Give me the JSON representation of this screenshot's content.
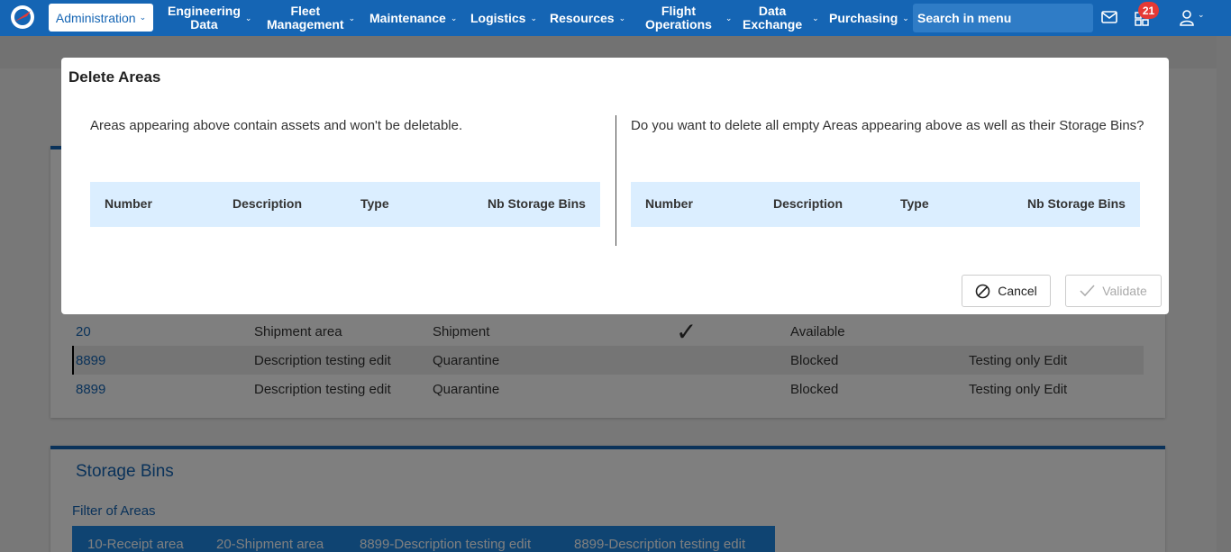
{
  "nav": {
    "admin": "Administration",
    "items": [
      {
        "l1": "Engineering",
        "l2": "Data"
      },
      {
        "l1": "Fleet",
        "l2": "Management"
      },
      {
        "l1": "Maintenance",
        "l2": ""
      },
      {
        "l1": "Logistics",
        "l2": ""
      },
      {
        "l1": "Resources",
        "l2": ""
      },
      {
        "l1": "Flight",
        "l2": "Operations"
      },
      {
        "l1": "Data",
        "l2": "Exchange"
      },
      {
        "l1": "Purchasing",
        "l2": ""
      }
    ],
    "search_placeholder": "Search in menu",
    "notifications_count": "21",
    "brand_color": "#1565b4"
  },
  "areas_table": {
    "rows": [
      {
        "number": "20",
        "description": "Shipment area",
        "type": "Shipment",
        "check": "✓",
        "status": "Available",
        "comment": ""
      },
      {
        "number": "8899",
        "description": "Description testing edit",
        "type": "Quarantine",
        "check": "",
        "status": "Blocked",
        "comment": "Testing only Edit"
      },
      {
        "number": "8899",
        "description": "Description testing edit",
        "type": "Quarantine",
        "check": "",
        "status": "Blocked",
        "comment": "Testing only Edit"
      }
    ]
  },
  "storage_bins": {
    "title": "Storage Bins",
    "filter_label": "Filter of Areas",
    "chips": [
      "10-Receipt area",
      "20-Shipment area",
      "8899-Description testing edit",
      "8899-Description testing edit"
    ]
  },
  "modal": {
    "title": "Delete Areas",
    "left_message": "Areas appearing above contain assets and won't be deletable.",
    "right_message": "Do you want to delete all empty Areas appearing above as well as their Storage Bins?",
    "columns": [
      "Number",
      "Description",
      "Type",
      "Nb Storage Bins"
    ],
    "cancel_label": "Cancel",
    "validate_label": "Validate"
  }
}
